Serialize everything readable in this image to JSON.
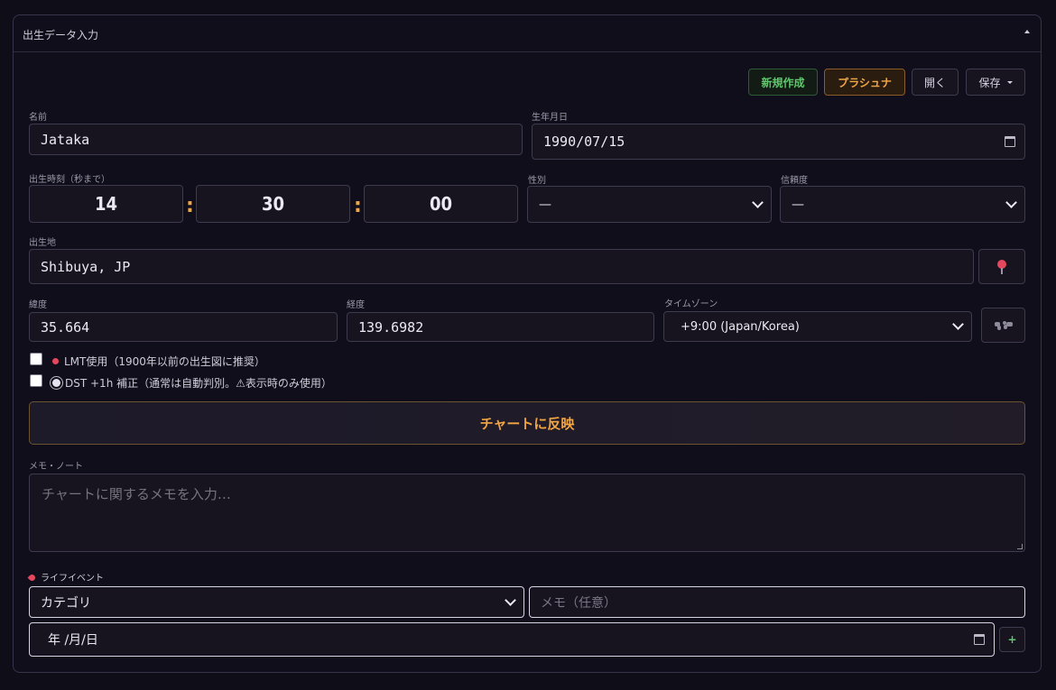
{
  "panel": {
    "title": "出生データ入力"
  },
  "toolbar": {
    "new_label": "新規作成",
    "prashna_label": "プラシュナ",
    "open_label": "開く",
    "save_label": "保存"
  },
  "name": {
    "label": "名前",
    "value": "Jataka"
  },
  "birthdate": {
    "label": "生年月日",
    "value": "1990/07/15"
  },
  "birthtime": {
    "label": "出生時刻（秒まで）",
    "hour": "14",
    "minute": "30",
    "second": "00",
    "separator": ":"
  },
  "gender": {
    "label": "性別",
    "value": "—"
  },
  "reliability": {
    "label": "信頼度",
    "value": "—"
  },
  "birthplace": {
    "label": "出生地",
    "value": "Shibuya, JP"
  },
  "latitude": {
    "label": "緯度",
    "value": "35.664"
  },
  "longitude": {
    "label": "経度",
    "value": "139.6982"
  },
  "timezone": {
    "label": "タイムゾーン",
    "value": "+9:00 (Japan/Korea)"
  },
  "options": {
    "lmt_label": "LMT使用（1900年以前の出生図に推奨）",
    "dst_label": "DST +1h 補正（通常は自動判別。⚠表示時のみ使用）"
  },
  "reflect_button": "チャートに反映",
  "memo": {
    "label": "メモ・ノート",
    "placeholder": "チャートに関するメモを入力…"
  },
  "life_events": {
    "label": "ライフイベント",
    "category_value": "カテゴリ",
    "note_placeholder": "メモ（任意）",
    "date_placeholder": "年 /月/日",
    "add_label": "+"
  },
  "colors": {
    "accent": "#f2a545",
    "success": "#62c46f",
    "pin": "#e5485e"
  }
}
